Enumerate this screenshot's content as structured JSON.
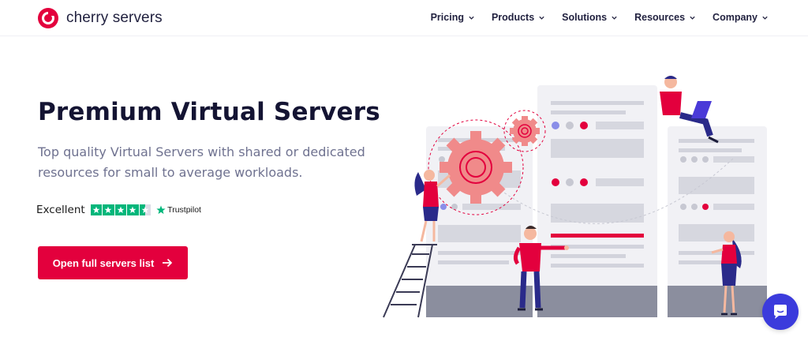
{
  "brand": {
    "name": "cherry servers",
    "color": "#e3003d"
  },
  "nav": {
    "items": [
      {
        "label": "Pricing"
      },
      {
        "label": "Products"
      },
      {
        "label": "Solutions"
      },
      {
        "label": "Resources"
      },
      {
        "label": "Company"
      }
    ]
  },
  "hero": {
    "title": "Premium Virtual Servers",
    "subtitle": "Top quality Virtual Servers with shared or dedicated resources for small to average workloads.",
    "cta_label": "Open full servers list"
  },
  "trustpilot": {
    "rating_text": "Excellent",
    "brand": "Trustpilot",
    "stars": 4.5,
    "color": "#00b67a"
  },
  "chat": {
    "icon": "chat-bubble-icon",
    "color": "#3b3bdc"
  }
}
